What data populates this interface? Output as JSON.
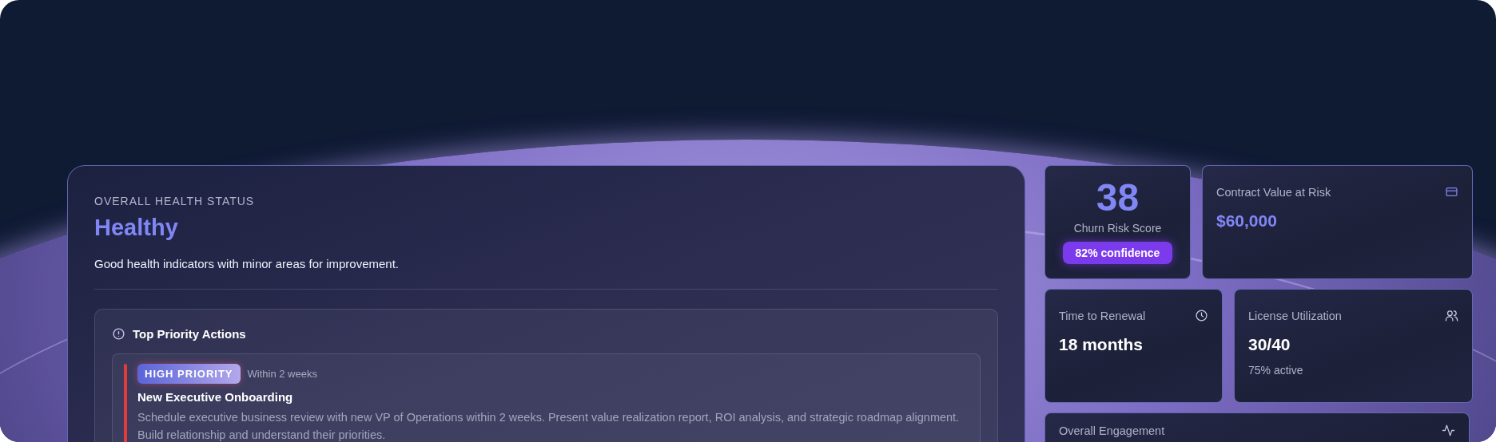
{
  "health": {
    "label": "OVERALL HEALTH STATUS",
    "status": "Healthy",
    "description": "Good health indicators with minor areas for improvement."
  },
  "priority_actions": {
    "title": "Top Priority Actions",
    "items": [
      {
        "priority": "HIGH PRIORITY",
        "timeframe": "Within 2 weeks",
        "title": "New Executive Onboarding",
        "description": "Schedule executive business review with new VP of Operations within 2 weeks. Present value realization report, ROI analysis, and strategic roadmap alignment. Build relationship and understand their priorities."
      }
    ]
  },
  "metrics": [
    {
      "kind": "score",
      "value": "38",
      "label": "Churn Risk Score",
      "badge": "82% confidence"
    },
    {
      "kind": "currency",
      "label": "Contract Value at Risk",
      "value": "$60,000"
    },
    {
      "kind": "time",
      "label": "Time to Renewal",
      "value": "18 months"
    },
    {
      "kind": "users",
      "label": "License Utilization",
      "value": "30/40",
      "note": "75% active"
    },
    {
      "kind": "activity",
      "label": "Overall Engagement"
    }
  ]
}
